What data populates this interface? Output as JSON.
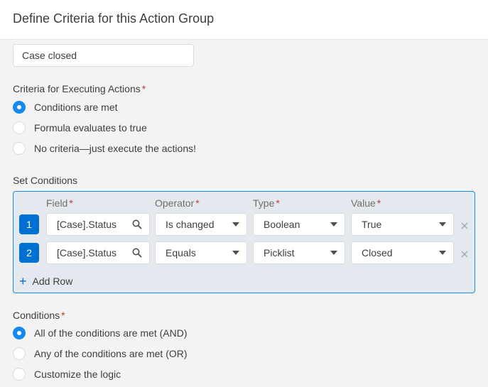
{
  "header": {
    "title": "Define Criteria for this Action Group"
  },
  "action_group_name": {
    "value": "Case closed"
  },
  "criteria": {
    "label": "Criteria for Executing Actions",
    "required_mark": "*",
    "options": [
      {
        "label": "Conditions are met",
        "checked": true
      },
      {
        "label": "Formula evaluates to true",
        "checked": false
      },
      {
        "label": "No criteria—just execute the actions!",
        "checked": false
      }
    ]
  },
  "set_conditions": {
    "label": "Set Conditions",
    "columns": {
      "field": "Field",
      "operator": "Operator",
      "type": "Type",
      "value": "Value",
      "required_mark": "*"
    },
    "rows": [
      {
        "num": "1",
        "field": "[Case].Status",
        "operator": "Is changed",
        "type": "Boolean",
        "value": "True"
      },
      {
        "num": "2",
        "field": "[Case].Status",
        "operator": "Equals",
        "type": "Picklist",
        "value": "Closed"
      }
    ],
    "add_row_label": "Add Row"
  },
  "conditions": {
    "label": "Conditions",
    "required_mark": "*",
    "options": [
      {
        "label": "All of the conditions are met (AND)",
        "checked": true
      },
      {
        "label": "Any of the conditions are met (OR)",
        "checked": false
      },
      {
        "label": "Customize the logic",
        "checked": false
      }
    ]
  },
  "colors": {
    "accent": "#1589ee",
    "row_badge": "#0070d2",
    "required": "#c23934"
  },
  "icons": {
    "search": "search-icon",
    "dropdown": "chevron-down-icon",
    "remove": "close-icon",
    "add": "plus-icon"
  }
}
